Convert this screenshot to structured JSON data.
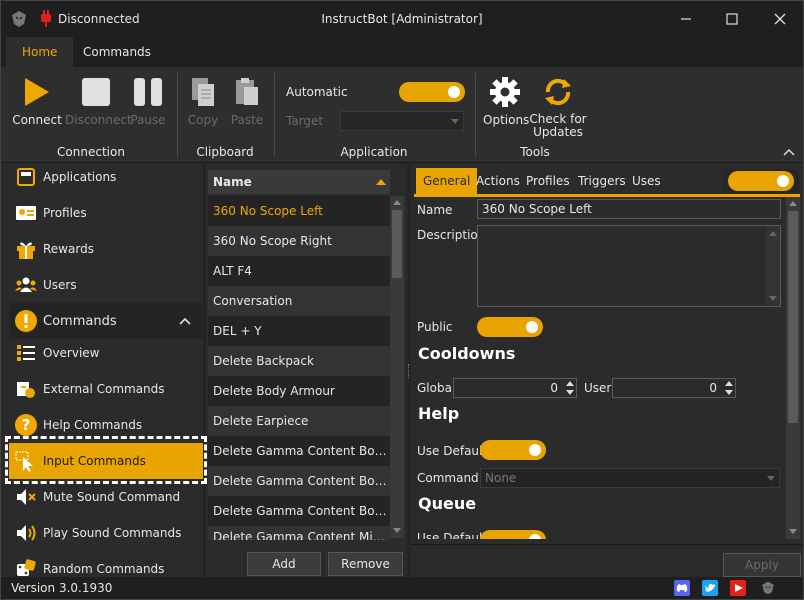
{
  "window": {
    "status": "Disconnected",
    "title": "InstructBot [Administrator]"
  },
  "ribbon_tabs": [
    "Home",
    "Commands"
  ],
  "ribbon": {
    "connect": "Connect",
    "disconnect": "Disconnect",
    "pause": "Pause",
    "copy": "Copy",
    "paste": "Paste",
    "automatic": "Automatic",
    "target": "Target",
    "options": "Options",
    "check_updates": "Check for Updates",
    "groups": [
      "Connection",
      "Clipboard",
      "Application",
      "Tools"
    ]
  },
  "sidebar": {
    "items": [
      {
        "label": "Applications",
        "icon": "applications-icon"
      },
      {
        "label": "Profiles",
        "icon": "profiles-icon"
      },
      {
        "label": "Rewards",
        "icon": "gift-icon"
      },
      {
        "label": "Users",
        "icon": "users-icon"
      }
    ],
    "section": "Commands",
    "sub_items": [
      {
        "label": "Overview",
        "icon": "list-icon"
      },
      {
        "label": "External Commands",
        "icon": "external-icon"
      },
      {
        "label": "Help Commands",
        "icon": "help-icon"
      },
      {
        "label": "Input Commands",
        "icon": "cursor-icon"
      },
      {
        "label": "Mute Sound Command",
        "icon": "mute-icon"
      },
      {
        "label": "Play Sound Commands",
        "icon": "speaker-icon"
      },
      {
        "label": "Random Commands",
        "icon": "dice-icon"
      }
    ]
  },
  "list": {
    "header": "Name",
    "rows": [
      "360 No Scope Left",
      "360 No Scope Right",
      "ALT F4",
      "Conversation",
      "DEL + Y",
      "Delete Backpack",
      "Delete Body Armour",
      "Delete Earpiece",
      "Delete Gamma Content Bottom Center",
      "Delete Gamma Content Bottom Left",
      "Delete Gamma Content Bottom Right",
      "Delete Gamma Content Middle Right"
    ],
    "add": "Add",
    "remove": "Remove"
  },
  "detail": {
    "tabs": [
      "General",
      "Actions",
      "Profiles",
      "Triggers",
      "Uses"
    ],
    "name_label": "Name",
    "name_value": "360 No Scope Left",
    "description_label": "Description",
    "public_label": "Public",
    "cooldowns": "Cooldowns",
    "global_label": "Global",
    "global_value": "0",
    "user_label": "User",
    "user_value": "0",
    "help": "Help",
    "use_default": "Use Default",
    "command_label": "Command",
    "command_value": "None",
    "queue": "Queue",
    "queue_use_default": "Use Default",
    "apply": "Apply"
  },
  "status": {
    "version": "Version 3.0.1930"
  },
  "colors": {
    "accent": "#e8a400",
    "background": "#2b2b2b"
  }
}
